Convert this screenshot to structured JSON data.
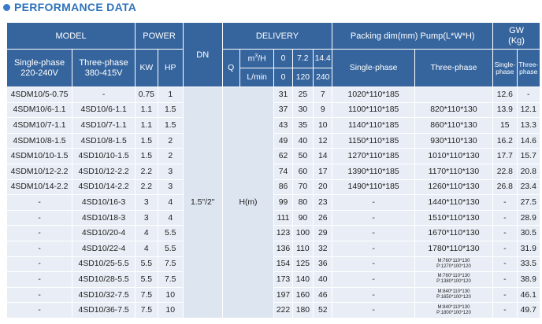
{
  "section_title": "PERFORMANCE DATA",
  "header": {
    "model": "MODEL",
    "power": "POWER",
    "dn": "DN",
    "delivery": "DELIVERY",
    "packing": "Packing dim(mm)  Pump(L*W*H)",
    "gw": "GW\n(Kg)",
    "single_phase_volt": "Single-phase\n220-240V",
    "three_phase_volt": "Three-phase\n380-415V",
    "kw": "KW",
    "hp": "HP",
    "q": "Q",
    "m3h": "m",
    "m3h_sup": "3",
    "m3h_tail": "/H",
    "lmin": "L/min",
    "flow_m3h": [
      "0",
      "7.2",
      "14.4"
    ],
    "flow_lmin": [
      "0",
      "120",
      "240"
    ],
    "packing_single": "Single-phase",
    "packing_three": "Three-phase",
    "gw_single": "Single-\nphase",
    "gw_three": "Three-\nphase"
  },
  "dn_value": "1.5\"/2\"",
  "head_label": "H(m)",
  "rows": [
    {
      "s": "4SDM10/5-0.75",
      "t": "-",
      "kw": "0.75",
      "hp": "1",
      "h": [
        "31",
        "25",
        "7"
      ],
      "ps": "1020*110*185",
      "pt": "",
      "gs": "12.6",
      "gt": "-"
    },
    {
      "s": "4SDM10/6-1.1",
      "t": "4SD10/6-1.1",
      "kw": "1.1",
      "hp": "1.5",
      "h": [
        "37",
        "30",
        "9"
      ],
      "ps": "1100*110*185",
      "pt": "820*110*130",
      "gs": "13.9",
      "gt": "12.1"
    },
    {
      "s": "4SDM10/7-1.1",
      "t": "4SD10/7-1.1",
      "kw": "1.1",
      "hp": "1.5",
      "h": [
        "43",
        "35",
        "10"
      ],
      "ps": "1140*110*185",
      "pt": "860*110*130",
      "gs": "15",
      "gt": "13.3"
    },
    {
      "s": "4SDM10/8-1.5",
      "t": "4SD10/8-1.5",
      "kw": "1.5",
      "hp": "2",
      "h": [
        "49",
        "40",
        "12"
      ],
      "ps": "1150*110*185",
      "pt": "930*110*130",
      "gs": "16.2",
      "gt": "14.6"
    },
    {
      "s": "4SDM10/10-1.5",
      "t": "4SD10/10-1.5",
      "kw": "1.5",
      "hp": "2",
      "h": [
        "62",
        "50",
        "14"
      ],
      "ps": "1270*110*185",
      "pt": "1010*110*130",
      "gs": "17.7",
      "gt": "15.7"
    },
    {
      "s": "4SDM10/12-2.2",
      "t": "4SD10/12-2.2",
      "kw": "2.2",
      "hp": "3",
      "h": [
        "74",
        "60",
        "17"
      ],
      "ps": "1390*110*185",
      "pt": "1170*110*130",
      "gs": "22.8",
      "gt": "20.8"
    },
    {
      "s": "4SDM10/14-2.2",
      "t": "4SD10/14-2.2",
      "kw": "2.2",
      "hp": "3",
      "h": [
        "86",
        "70",
        "20"
      ],
      "ps": "1490*110*185",
      "pt": "1260*110*130",
      "gs": "26.8",
      "gt": "23.4"
    },
    {
      "s": "-",
      "t": "4SD10/16-3",
      "kw": "3",
      "hp": "4",
      "h": [
        "99",
        "80",
        "23"
      ],
      "ps": "-",
      "pt": "1440*110*130",
      "gs": "-",
      "gt": "27.5"
    },
    {
      "s": "-",
      "t": "4SD10/18-3",
      "kw": "3",
      "hp": "4",
      "h": [
        "111",
        "90",
        "26"
      ],
      "ps": "-",
      "pt": "1510*110*130",
      "gs": "-",
      "gt": "28.9"
    },
    {
      "s": "-",
      "t": "4SD10/20-4",
      "kw": "4",
      "hp": "5.5",
      "h": [
        "123",
        "100",
        "29"
      ],
      "ps": "-",
      "pt": "1670*110*130",
      "gs": "-",
      "gt": "30.5"
    },
    {
      "s": "-",
      "t": "4SD10/22-4",
      "kw": "4",
      "hp": "5.5",
      "h": [
        "136",
        "110",
        "32"
      ],
      "ps": "-",
      "pt": "1780*110*130",
      "gs": "-",
      "gt": "31.9"
    },
    {
      "s": "-",
      "t": "4SD10/25-5.5",
      "kw": "5.5",
      "hp": "7.5",
      "h": [
        "154",
        "125",
        "36"
      ],
      "ps": "-",
      "pt": "M:760*110*130\nP:1270*100*120",
      "small": true,
      "gs": "-",
      "gt": "33.5"
    },
    {
      "s": "-",
      "t": "4SD10/28-5.5",
      "kw": "5.5",
      "hp": "7.5",
      "h": [
        "173",
        "140",
        "40"
      ],
      "ps": "-",
      "pt": "M:760*110*130\nP:1380*100*120",
      "small": true,
      "gs": "-",
      "gt": "38.9"
    },
    {
      "s": "-",
      "t": "4SD10/32-7.5",
      "kw": "7.5",
      "hp": "10",
      "h": [
        "197",
        "160",
        "46"
      ],
      "ps": "-",
      "pt": "M:840*110*130\nP:1650*100*120",
      "small": true,
      "gs": "-",
      "gt": "46.1"
    },
    {
      "s": "-",
      "t": "4SD10/36-7.5",
      "kw": "7.5",
      "hp": "10",
      "h": [
        "222",
        "180",
        "52"
      ],
      "ps": "-",
      "pt": "M:840*110*130\nP:1800*100*120",
      "small": true,
      "gs": "-",
      "gt": "49.7"
    }
  ]
}
